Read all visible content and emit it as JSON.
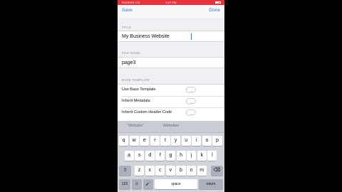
{
  "status_bar": {
    "carrier": "ROGERS  LTE",
    "time": "5:07 PM"
  },
  "nav": {
    "save_label": "Save",
    "done_label": "Done"
  },
  "form": {
    "title_header": "TITLE",
    "title_value": "My Business Website",
    "file_name_header": "FILE NAME",
    "file_name_value": "page3",
    "base_template_header": "BASE TEMPLATE",
    "toggles": [
      {
        "label": "Use Base Template",
        "on": false
      },
      {
        "label": "Inherit Metadata",
        "on": false
      },
      {
        "label": "Inherit Custom Header Code",
        "on": false
      }
    ]
  },
  "keyboard": {
    "suggestions": [
      "\"Website\"",
      "Websites",
      ""
    ],
    "row1": [
      "q",
      "w",
      "e",
      "r",
      "t",
      "y",
      "u",
      "i",
      "o",
      "p"
    ],
    "row2": [
      "a",
      "s",
      "d",
      "f",
      "g",
      "h",
      "j",
      "k",
      "l"
    ],
    "row3": [
      "z",
      "x",
      "c",
      "v",
      "b",
      "n",
      "m"
    ],
    "shift_icon": "shift-icon",
    "delete_icon": "delete-icon",
    "numbers_label": "123",
    "emoji_icon": "emoji-icon",
    "mic_icon": "mic-icon",
    "space_label": "space",
    "return_label": "return"
  },
  "colors": {
    "status_bar": "#e8313b",
    "accent": "#2f7de1"
  }
}
